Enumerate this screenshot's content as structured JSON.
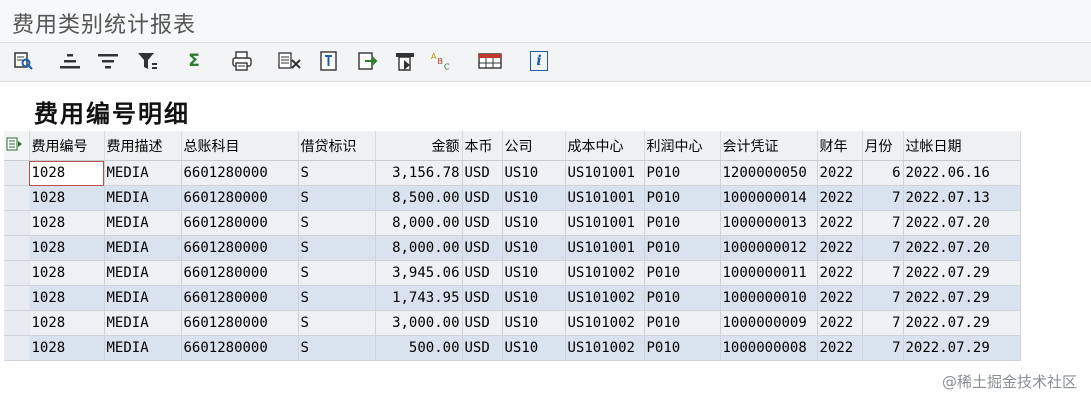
{
  "window": {
    "title": "费用类别统计报表"
  },
  "section": {
    "title": "费用编号明细"
  },
  "toolbar": {
    "icons": [
      "details-icon",
      "sort-ascending-icon",
      "sort-descending-icon",
      "filter-icon",
      "sum-icon",
      "print-icon",
      "export-excel-icon",
      "word-processing-icon",
      "local-file-icon",
      "abc-analysis-icon",
      "select-layout-icon",
      "info-icon"
    ],
    "sum_glyph": "Σ",
    "info_glyph": "i",
    "abc_a": "A",
    "abc_b": "B",
    "abc_c": "C"
  },
  "table": {
    "columns": [
      "费用编号",
      "费用描述",
      "总账科目",
      "借贷标识",
      "金额",
      "本币",
      "公司",
      "成本中心",
      "利润中心",
      "会计凭证",
      "财年",
      "月份",
      "过帐日期"
    ],
    "rows": [
      [
        "1028",
        "MEDIA",
        "6601280000",
        "S",
        "3,156.78",
        "USD",
        "US10",
        "US101001",
        "P010",
        "1200000050",
        "2022",
        "6",
        "2022.06.16"
      ],
      [
        "1028",
        "MEDIA",
        "6601280000",
        "S",
        "8,500.00",
        "USD",
        "US10",
        "US101001",
        "P010",
        "1000000014",
        "2022",
        "7",
        "2022.07.13"
      ],
      [
        "1028",
        "MEDIA",
        "6601280000",
        "S",
        "8,000.00",
        "USD",
        "US10",
        "US101001",
        "P010",
        "1000000013",
        "2022",
        "7",
        "2022.07.20"
      ],
      [
        "1028",
        "MEDIA",
        "6601280000",
        "S",
        "8,000.00",
        "USD",
        "US10",
        "US101001",
        "P010",
        "1000000012",
        "2022",
        "7",
        "2022.07.20"
      ],
      [
        "1028",
        "MEDIA",
        "6601280000",
        "S",
        "3,945.06",
        "USD",
        "US10",
        "US101002",
        "P010",
        "1000000011",
        "2022",
        "7",
        "2022.07.29"
      ],
      [
        "1028",
        "MEDIA",
        "6601280000",
        "S",
        "1,743.95",
        "USD",
        "US10",
        "US101002",
        "P010",
        "1000000010",
        "2022",
        "7",
        "2022.07.29"
      ],
      [
        "1028",
        "MEDIA",
        "6601280000",
        "S",
        "3,000.00",
        "USD",
        "US10",
        "US101002",
        "P010",
        "1000000009",
        "2022",
        "7",
        "2022.07.29"
      ],
      [
        "1028",
        "MEDIA",
        "6601280000",
        "S",
        "500.00",
        "USD",
        "US10",
        "US101002",
        "P010",
        "1000000008",
        "2022",
        "7",
        "2022.07.29"
      ]
    ]
  },
  "watermark": "@稀土掘金技术社区",
  "colors": {
    "accent": "#1a5fa8",
    "row_even": "#d9e3ef",
    "row_odd": "#eef1f4"
  }
}
